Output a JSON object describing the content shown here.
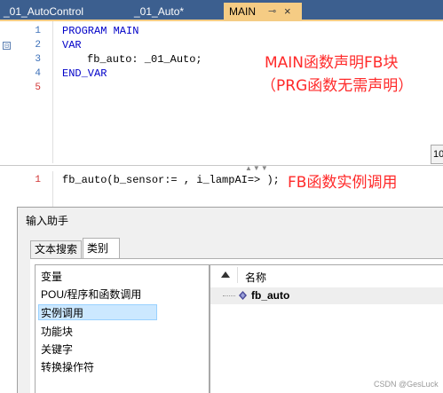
{
  "tabs": [
    {
      "label": "_01_AutoControl"
    },
    {
      "label": "_01_Auto*"
    },
    {
      "label": "MAIN",
      "pin": "⊸",
      "close": "×"
    }
  ],
  "upper_editor": {
    "lines": [
      {
        "number": "1",
        "code": "PROGRAM MAIN"
      },
      {
        "number": "2",
        "code": "VAR"
      },
      {
        "number": "3",
        "code": "fb_auto: _01_Auto;"
      },
      {
        "number": "4",
        "code": "END_VAR"
      },
      {
        "number": "5",
        "code": ""
      }
    ],
    "fold_symbol": "⊟",
    "annotation_line1": "MAIN函数声明FB块",
    "annotation_line2": "（PRG函数无需声明）",
    "side_button": "10"
  },
  "lower_editor": {
    "line_number": "1",
    "code_func": "fb_auto",
    "code_args": "(b_sensor:= , i_lampAI=> );",
    "annotation": "FB函数实例调用"
  },
  "dialog": {
    "title": "输入助手",
    "tabs": [
      "文本搜索",
      "类别"
    ],
    "categories": [
      "变量",
      "POU/程序和函数调用",
      "实例调用",
      "功能块",
      "关键字",
      "转换操作符"
    ],
    "selected_index": 2,
    "column_header": "名称",
    "result_item": "fb_auto"
  },
  "colors": {
    "tabbar": "#3c5f8f",
    "active_tab": "#f5cc84",
    "keyword": "#0000c8",
    "annotation": "#ff2a2a",
    "selection": "#cce8ff"
  },
  "watermark": "CSDN @GesLuck"
}
